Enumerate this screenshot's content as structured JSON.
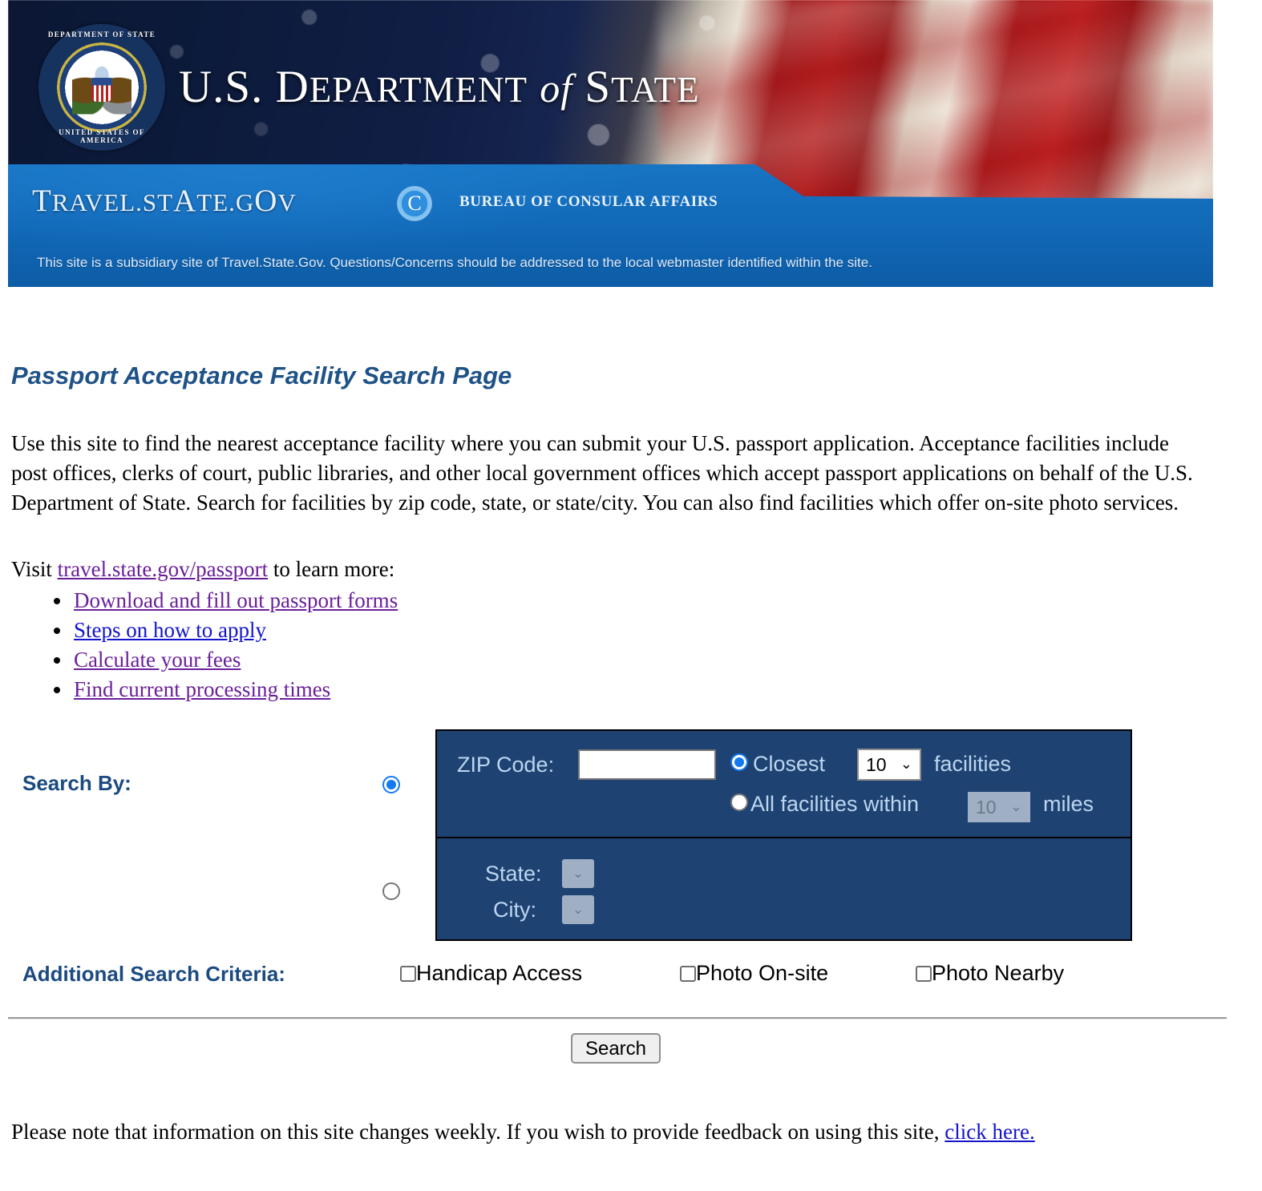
{
  "banner": {
    "seal_ring_top": "DEPARTMENT OF STATE",
    "seal_ring_bottom": "UNITED STATES OF AMERICA",
    "department_title_prefix": "U.S. D",
    "department_title_sc1": "EPARTMENT",
    "department_title_of": "of",
    "department_title_s": "S",
    "department_title_sc2": "TATE",
    "travel_t": "T",
    "travel_sc": "RAVEL.ST",
    "travel_a": "A",
    "travel_sc2": "TE.G",
    "travel_o": "O",
    "travel_sc3": "V",
    "consular_logo_glyph": "C",
    "bureau_text": "BUREAU OF CONSULAR AFFAIRS",
    "subsidiary_notice": "This site is a subsidiary site of Travel.State.Gov. Questions/Concerns should be addressed to the local webmaster identified within the site.",
    "band_color": "#1168b6"
  },
  "page": {
    "title": "Passport Acceptance Facility Search Page",
    "title_color": "#1f5287",
    "intro": "Use this site to find the nearest acceptance facility where you can submit your U.S. passport application. Acceptance facilities include post offices, clerks of court, public libraries, and other local government offices which accept passport applications on behalf of the U.S. Department of State. Search for facilities by zip code, state, or state/city. You can also find facilities which offer on-site photo services.",
    "visit_prefix": "Visit ",
    "visit_link": "travel.state.gov/passport",
    "visit_suffix": " to learn more:",
    "links": [
      {
        "label": "Download and fill out passport forms",
        "state": "visited"
      },
      {
        "label": "Steps on how to apply",
        "state": "unvisited"
      },
      {
        "label": "Calculate your fees",
        "state": "visited"
      },
      {
        "label": "Find current processing times",
        "state": "visited"
      }
    ],
    "footer_prefix": "Please note that information on this site changes weekly. If you wish to provide feedback on using this site, ",
    "footer_link": "click here."
  },
  "search_form": {
    "search_by_label": "Search By:",
    "selected_mode": "zip",
    "panel_bg": "#1e4372",
    "zip": {
      "label": "ZIP Code:",
      "value": "",
      "placeholder": "",
      "mode": "closest",
      "closest_label": "Closest",
      "closest_count": "10",
      "facilities_label": "facilities",
      "all_within_label": "All facilities within",
      "miles_value": "10",
      "miles_label": "miles",
      "chevron": "⌄"
    },
    "state_city": {
      "state_label": "State:",
      "state_value": "",
      "city_label": "City:",
      "city_value": "",
      "chevron": "⌄"
    }
  },
  "criteria": {
    "label": "Additional Search Criteria:",
    "items": [
      {
        "label": "Handicap Access",
        "checked": false
      },
      {
        "label": "Photo On-site",
        "checked": false
      },
      {
        "label": "Photo Nearby",
        "checked": false
      }
    ]
  },
  "actions": {
    "search_label": "Search"
  }
}
